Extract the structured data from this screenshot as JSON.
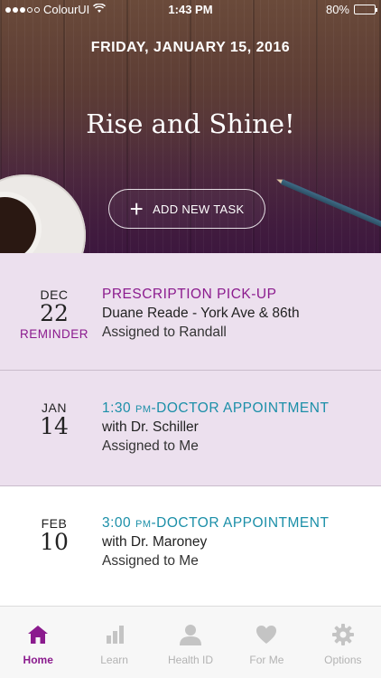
{
  "status": {
    "carrier": "ColourUI",
    "time": "1:43 PM",
    "battery": "80%",
    "battery_level": 0.8,
    "signal_bars": 3
  },
  "hero": {
    "date": "FRIDAY, JANUARY 15, 2016",
    "greeting": "Rise and Shine!",
    "add_task_label": "ADD NEW TASK"
  },
  "tasks": [
    {
      "month": "DEC",
      "day": "22",
      "tag": "REMINDER",
      "title": "PRESCRIPTION PICK-UP",
      "subtitle": "Duane Reade - York Ave & 86th",
      "assigned": "Assigned to Randall"
    },
    {
      "month": "JAN",
      "day": "14",
      "time": "1:30",
      "ampm": "PM",
      "title": "-DOCTOR APPOINTMENT",
      "subtitle": "with Dr. Schiller",
      "assigned": "Assigned to Me"
    },
    {
      "month": "FEB",
      "day": "10",
      "time": "3:00",
      "ampm": "PM",
      "title": "-DOCTOR APPOINTMENT",
      "subtitle": "with Dr. Maroney",
      "assigned": "Assigned to Me"
    }
  ],
  "tabs": [
    {
      "label": "Home",
      "icon": "home-icon"
    },
    {
      "label": "Learn",
      "icon": "bar-chart-icon"
    },
    {
      "label": "Health ID",
      "icon": "person-icon"
    },
    {
      "label": "For Me",
      "icon": "heart-icon"
    },
    {
      "label": "Options",
      "icon": "gear-icon"
    }
  ],
  "colors": {
    "accent": "#8b1b8e",
    "teal": "#1b8fa8",
    "task_bg": "#ece0ee"
  }
}
